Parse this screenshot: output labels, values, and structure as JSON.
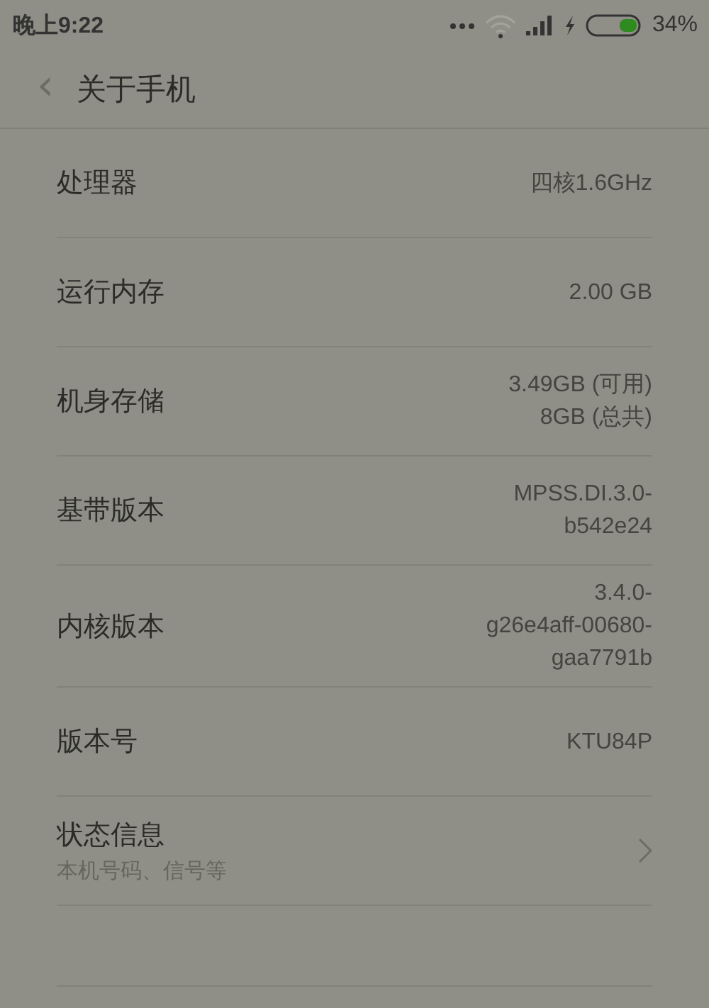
{
  "status_bar": {
    "time": "晚上9:22",
    "battery_text": "34%"
  },
  "header": {
    "back": "‹",
    "title": "关于手机"
  },
  "rows": [
    {
      "kind": "value",
      "label": "处理器",
      "value_lines": [
        "四核1.6GHz"
      ]
    },
    {
      "kind": "value",
      "label": "运行内存",
      "value_lines": [
        "2.00 GB"
      ]
    },
    {
      "kind": "value",
      "label": "机身存储",
      "value_lines": [
        "3.49GB (可用)",
        "8GB (总共)"
      ]
    },
    {
      "kind": "value",
      "label": "基带版本",
      "value_lines": [
        "MPSS.DI.3.0-",
        "b542e24"
      ]
    },
    {
      "kind": "value",
      "label": "内核版本",
      "value_lines": [
        "3.4.0-",
        "g26e4aff-00680-",
        "gaa7791b"
      ]
    },
    {
      "kind": "value",
      "label": "版本号",
      "value_lines": [
        "KTU84P"
      ]
    },
    {
      "kind": "link",
      "label": "状态信息",
      "subtitle": "本机号码、信号等"
    }
  ]
}
